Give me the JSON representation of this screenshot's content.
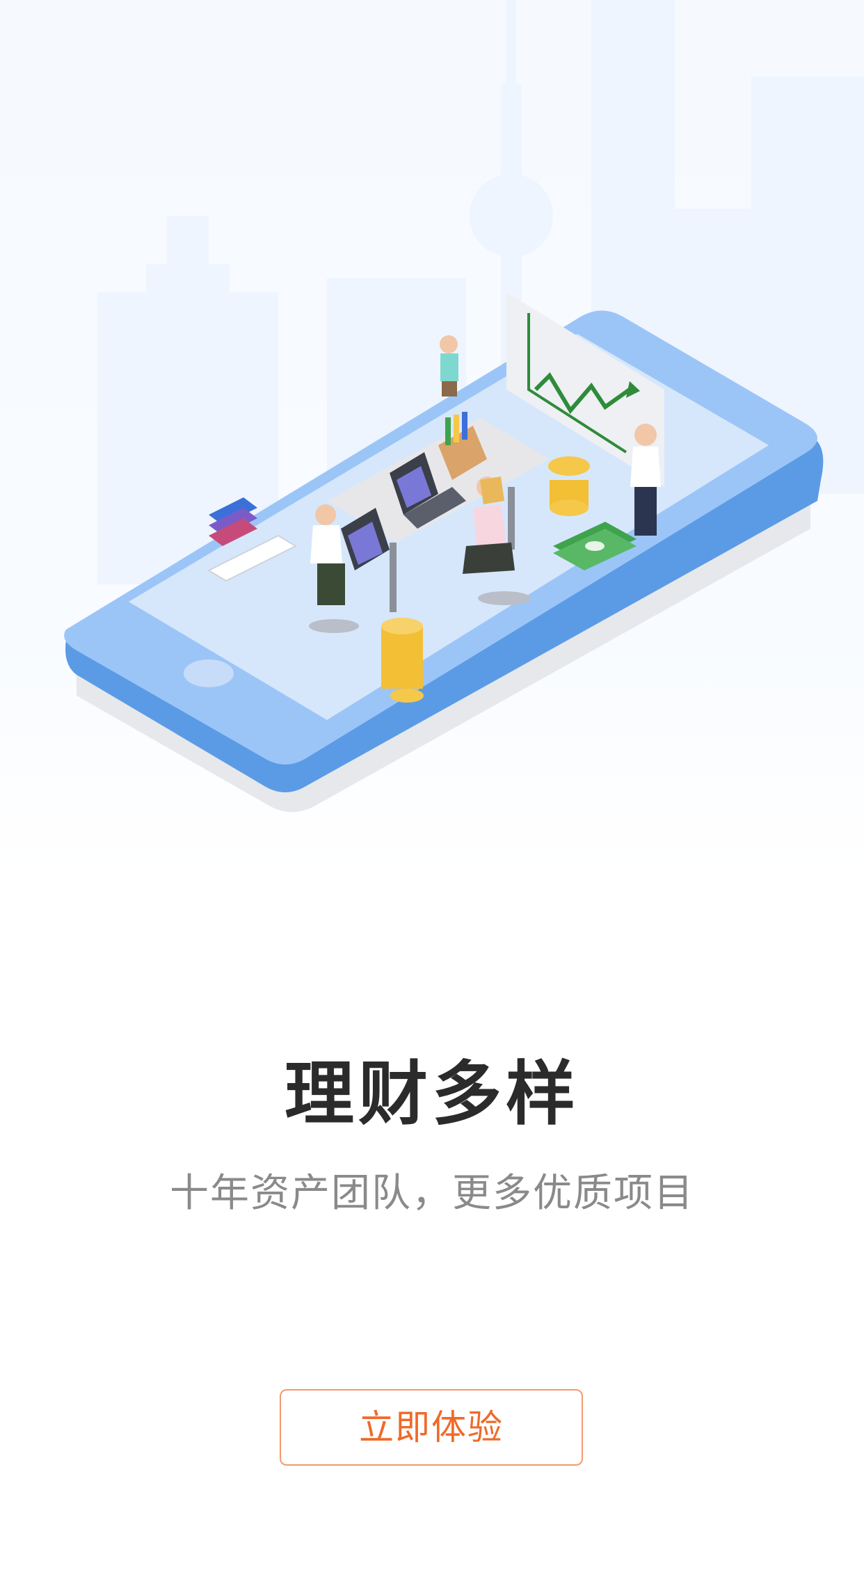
{
  "onboarding": {
    "title": "理财多样",
    "subtitle": "十年资产团队，更多优质项目",
    "cta_label": "立即体验"
  },
  "illustration": {
    "subject": "isometric-phone-office-scene",
    "colors": {
      "phone_body": "#5b9be6",
      "phone_screen": "#cfe2fb",
      "skyline": "#eaf3ff",
      "coin": "#f5c84a",
      "money": "#3fa34d",
      "chart_line": "#2e8b3a"
    }
  },
  "theme": {
    "accent": "#ef6a2a",
    "title_color": "#2b2b2b",
    "subtitle_color": "#8a8a8a"
  }
}
